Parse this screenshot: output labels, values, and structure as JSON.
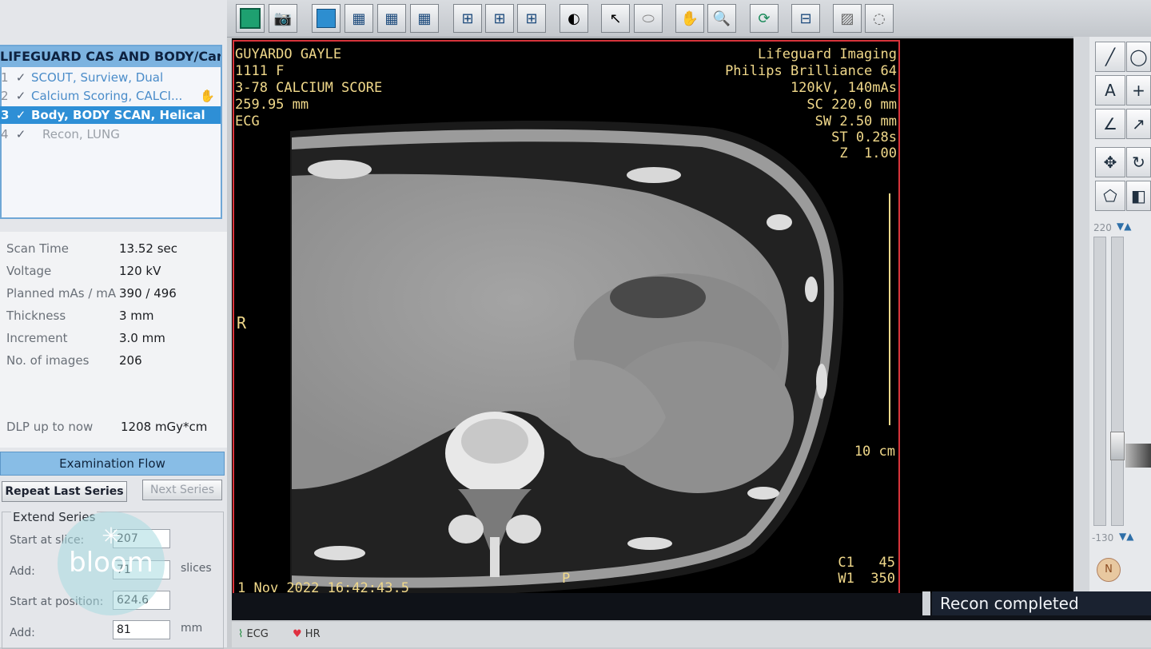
{
  "series_panel": {
    "title": "LIFEGUARD CAS AND BODY/Cardiac",
    "items": [
      {
        "num": "1",
        "label": "SCOUT, Surview, Dual"
      },
      {
        "num": "2",
        "label": "Calcium Scoring, CALCI..."
      },
      {
        "num": "3",
        "label": "Body, BODY SCAN, Helical"
      },
      {
        "num": "4",
        "label": "Recon, LUNG"
      }
    ]
  },
  "stats": {
    "scan_time_label": "Scan Time",
    "scan_time": "13.52 sec",
    "voltage_label": "Voltage",
    "voltage": "120 kV",
    "mas_label": "Planned mAs / mA",
    "mas": "390 / 496",
    "thickness_label": "Thickness",
    "thickness": "3 mm",
    "increment_label": "Increment",
    "increment": "3.0 mm",
    "images_label": "No. of images",
    "images": "206",
    "dlp_label": "DLP up to now",
    "dlp": "1208 mGy*cm"
  },
  "flow": {
    "title": "Examination Flow",
    "repeat": "Repeat Last Series",
    "next": "Next Series",
    "extend_title": "Extend Series",
    "start_slice_label": "Start at slice:",
    "start_slice": "207",
    "add_label": "Add:",
    "add_slices": "71",
    "slices_unit": "slices",
    "start_pos_label": "Start at position:",
    "start_pos": "624.6",
    "add2_label": "Add:",
    "add_mm": "81",
    "mm_unit": "mm"
  },
  "overlay": {
    "patient": "GUYARDO GAYLE",
    "id": "1111 F",
    "study": "3-78 CALCIUM SCORE",
    "fov": "259.95 mm",
    "ecg": "ECG",
    "site": "Lifeguard Imaging",
    "scanner": "Philips Brilliance 64",
    "kv_mas": "120kV, 140mAs",
    "sc": "SC 220.0 mm",
    "sw": "SW 2.50 mm",
    "st": "ST 0.28s",
    "z": "Z  1.00",
    "r": "R",
    "scale": "10 cm",
    "datetime": "1 Nov 2022 16:42:43.5",
    "p": "P",
    "cl": "C1   45",
    "wl": "W1  350"
  },
  "status": {
    "recon": "Recon completed",
    "ecg_tab": "ECG",
    "hr_tab": "HR"
  },
  "right_panel": {
    "top_value": "220",
    "bottom_value": "-130",
    "n_label": "N"
  },
  "watermark": {
    "text": "bloom"
  },
  "colors": {
    "accent": "#2e8fd6",
    "frame": "#d8343b",
    "overlay_text": "#f0d88a"
  }
}
